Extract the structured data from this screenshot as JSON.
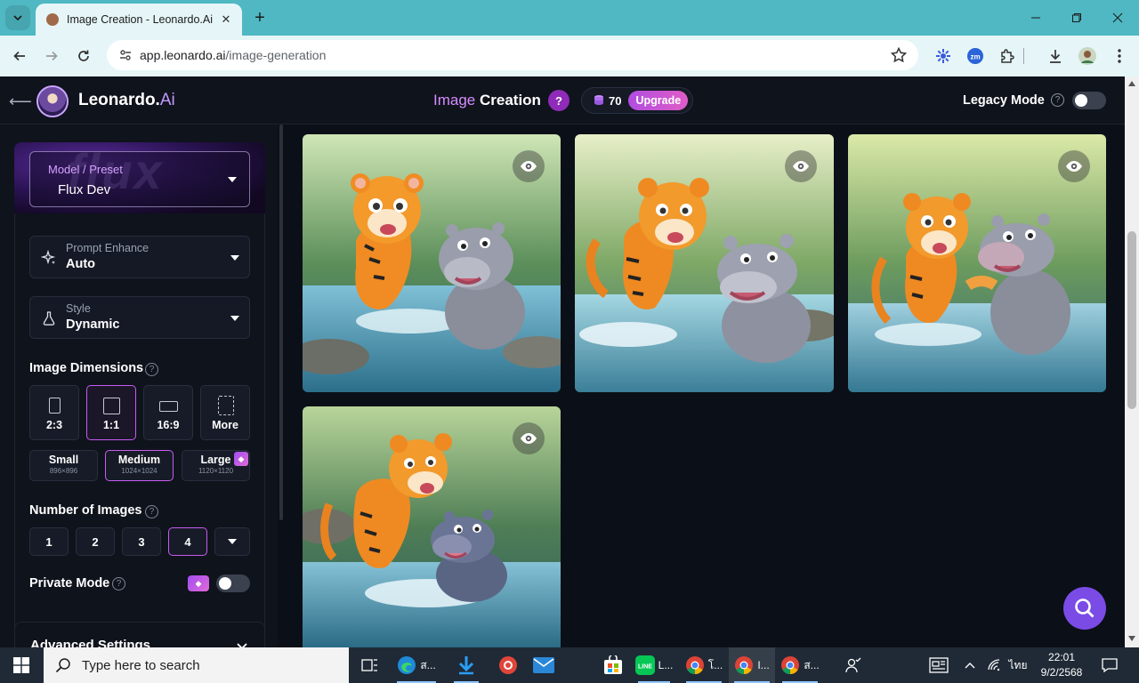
{
  "browser": {
    "tab_title": "Image Creation - Leonardo.Ai",
    "url_domain": "app.leonardo.ai",
    "url_path": "/image-generation",
    "new_tab_label": "+",
    "window_controls": [
      "minimize-icon",
      "restore-icon",
      "close-icon"
    ]
  },
  "header": {
    "brand_name": "Leonardo.",
    "brand_suffix": "Ai",
    "page_title_prefix": "Image",
    "page_title_main": "Creation",
    "help_label": "?",
    "token_count": "70",
    "upgrade_label": "Upgrade",
    "legacy_mode_label": "Legacy Mode",
    "legacy_mode_on": false
  },
  "sidebar": {
    "model": {
      "label": "Model / Preset",
      "value": "Flux Dev"
    },
    "prompt_enhance": {
      "label": "Prompt Enhance",
      "value": "Auto",
      "icon": "sparkle-icon"
    },
    "style": {
      "label": "Style",
      "value": "Dynamic",
      "icon": "flask-icon"
    },
    "image_dimensions": {
      "title": "Image Dimensions",
      "ratios": [
        {
          "label": "2:3",
          "selected": false
        },
        {
          "label": "1:1",
          "selected": true
        },
        {
          "label": "16:9",
          "selected": false
        },
        {
          "label": "More",
          "selected": false
        }
      ],
      "sizes": [
        {
          "label": "Small",
          "dims": "896×896",
          "selected": false,
          "premium": false
        },
        {
          "label": "Medium",
          "dims": "1024×1024",
          "selected": true,
          "premium": false
        },
        {
          "label": "Large",
          "dims": "1120×1120",
          "selected": false,
          "premium": true
        }
      ]
    },
    "number_of_images": {
      "title": "Number of Images",
      "options": [
        "1",
        "2",
        "3",
        "4"
      ],
      "selected": "4"
    },
    "private_mode": {
      "label": "Private Mode",
      "on": false
    },
    "advanced_settings": {
      "label": "Advanced Settings"
    }
  },
  "gallery": {
    "images": [
      {
        "alt": "cartoon-tiger-and-hippo-1",
        "icon": "eye-icon"
      },
      {
        "alt": "cartoon-tiger-and-hippo-2",
        "icon": "eye-icon"
      },
      {
        "alt": "cartoon-tiger-and-hippo-3",
        "icon": "eye-icon"
      },
      {
        "alt": "cartoon-tiger-and-hippo-4",
        "icon": "eye-icon"
      }
    ]
  },
  "taskbar": {
    "search_placeholder": "Type here to search",
    "items": [
      {
        "label": "ส...",
        "icon": "edge-icon"
      },
      {
        "label": "",
        "icon": "download-icon"
      },
      {
        "label": "",
        "icon": "app-icon"
      },
      {
        "label": "",
        "icon": "mail-icon"
      },
      {
        "label": "",
        "icon": "store-icon"
      },
      {
        "label": "L...",
        "icon": "line-icon"
      },
      {
        "label": "โ...",
        "icon": "chrome-icon"
      },
      {
        "label": "I...",
        "icon": "chrome-icon"
      },
      {
        "label": "ส...",
        "icon": "chrome-icon"
      }
    ],
    "language": "ไทย",
    "time": "22:01",
    "date": "9/2/2568"
  },
  "colors": {
    "accent": "#c65cf0",
    "app_bg": "#0b0f17",
    "chrome_tab_strip": "#4fb8c3",
    "fab": "#7b4be6"
  }
}
